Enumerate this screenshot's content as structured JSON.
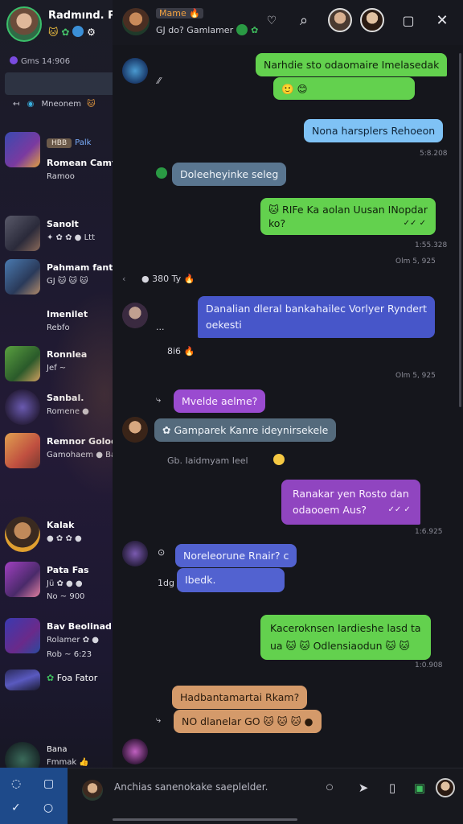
{
  "me": {
    "name": "Radmınd. Pam",
    "badges": "🐱 ✿"
  },
  "sidebar": {
    "status": "Gms 14:906",
    "tools": [
      "↤",
      "Mneonem"
    ],
    "conversations": [
      {
        "tag": "HBB",
        "tag2": "Palk",
        "name": "Romean Camt",
        "line": "Ramoo"
      },
      {
        "name": "Sanolt",
        "line": "✦ ✿ ✿ ● Ltt"
      },
      {
        "name": "Pahmam fant",
        "line": "GJ 🐱 🐱 🐱"
      },
      {
        "name": "Imenilet",
        "line": "Rebfo"
      },
      {
        "name": "Ronnlea",
        "line": "Jef ~"
      },
      {
        "name": "Sanbal.",
        "line": "Romene ●"
      },
      {
        "name": "Remnor Goloor",
        "line": "Gamohaem ● Ba"
      },
      {
        "name": "Kalak",
        "line": "● ✿ ✿ ●"
      },
      {
        "name": "Pata Fas",
        "line": "Jü ✿ ● ●"
      },
      {
        "name": "Bav Beolinad",
        "line": "Rolamer ✿ ●"
      },
      {
        "name": "Foa Fator",
        "line": ""
      },
      {
        "name": "Bana",
        "line": "Fmmak 👍"
      }
    ],
    "conv_sub": [
      "",
      "",
      "",
      "",
      "",
      "",
      "",
      "",
      "No ~ 900",
      "Rob ~ 6:23",
      "",
      ""
    ]
  },
  "header": {
    "title": "Mame 🔥",
    "subtitle": "GJ do? Gamlamer",
    "icons": [
      "heart-icon",
      "search-icon",
      "square-icon",
      "close-icon"
    ]
  },
  "messages": [
    {
      "text": "Narhdie sto odaomaire Imelasedak",
      "text2": "🙂 😊",
      "style": "green"
    },
    {
      "text": "Nona harsplers Rehoeon",
      "style": "lblue",
      "ts": "5:8.208"
    },
    {
      "text": "Doleeheyinke seleg",
      "style": "slate"
    },
    {
      "text": "🐱 RIFe Ka aolan Uusan INopdar",
      "text2": "ko?",
      "style": "green",
      "ts": "1:55.328",
      "tick": "✓✓ ✓"
    },
    {
      "ts": "Olm   5, 925"
    },
    {
      "sys": "● 380 Ty 🔥"
    },
    {
      "text": "Danalian dleral bankahailec Vorlyer Ryndert",
      "text2": "oekesti",
      "style": "indigo",
      "pre": "..."
    },
    {
      "sys": "8i6 🔥"
    },
    {
      "ts": "Olm   5, 925"
    },
    {
      "text": "Mvelde aelme?",
      "style": "purple"
    },
    {
      "text": "✿  Gamparek Kanre  ideynirsekele",
      "style": "gray"
    },
    {
      "sys": "Gb.  Iaidmyam Ieel"
    },
    {
      "text": "Ranakar yen Rosto dan",
      "text2": "odaooem Aus?",
      "style": "magenta",
      "ts": "1:6.925",
      "tick": "✓✓ ✓"
    },
    {
      "text": "Noreleorune Rnair? c",
      "style": "violet"
    },
    {
      "text": "Ibedk.",
      "style": "violet",
      "pre": "1dg"
    },
    {
      "text": "Kaceroknsen Iardieshe lasd ta",
      "text2": "ua 🐱 🐱 Odlensiaodun 🐱 🐱",
      "style": "green",
      "ts": "1:0.908"
    },
    {
      "text": "Hadbantamartai Rkam?",
      "style": "peach"
    },
    {
      "text": "NO dlanelar GO 🐱 🐱 🐱  ●",
      "style": "peach"
    }
  ],
  "composer": {
    "placeholder": "Anchias sanenokake saeplelder.",
    "icons": [
      "emoji-icon",
      "send-icon",
      "trash-icon",
      "save-icon",
      "profile-icon"
    ]
  }
}
